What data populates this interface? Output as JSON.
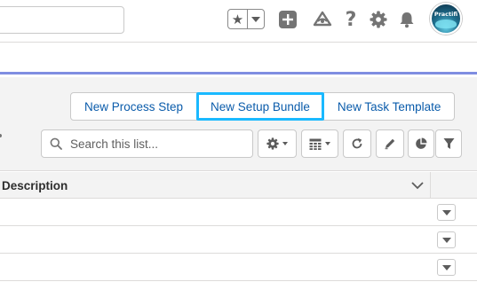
{
  "header": {
    "global_search_value": "",
    "icons": [
      "star-icon",
      "chevron-down-icon",
      "add-icon",
      "trailhead-icon",
      "help-icon",
      "setup-gear-icon",
      "notifications-bell-icon"
    ],
    "avatar_text": "Practifi"
  },
  "list_actions": {
    "buttons": [
      {
        "label": "New Process Step"
      },
      {
        "label": "New Setup Bundle"
      },
      {
        "label": "New Task Template"
      }
    ],
    "focused_button_index": 1
  },
  "list_toolbar": {
    "search_placeholder": "Search this list...",
    "tools": [
      "list-settings-gear-icon",
      "display-table-icon",
      "refresh-icon",
      "edit-icon",
      "chart-icon",
      "filter-icon"
    ]
  },
  "table": {
    "columns": [
      {
        "label": "Description"
      }
    ],
    "row_count_visible": 3
  },
  "colors": {
    "link_blue": "#0b5cab",
    "focus_ring": "#1ab9ff",
    "nav_accent": "#7f8de1",
    "header_bg": "#f3f3f3"
  }
}
